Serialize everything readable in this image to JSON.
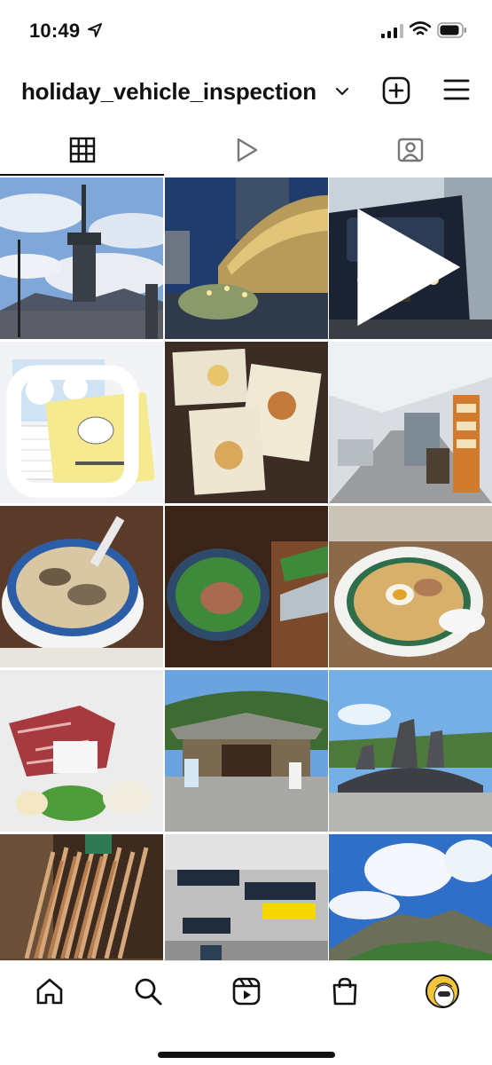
{
  "status_bar": {
    "time": "10:49"
  },
  "header": {
    "username": "holiday_vehicle_inspection"
  },
  "tabs": [
    {
      "name": "grid",
      "icon": "grid-icon",
      "active": true
    },
    {
      "name": "reels",
      "icon": "play-icon",
      "active": false
    },
    {
      "name": "tagged",
      "icon": "person-tag-icon",
      "active": false
    }
  ],
  "posts": [
    {
      "subject": "beppu-tower",
      "type": "photo"
    },
    {
      "subject": "station-building",
      "type": "photo"
    },
    {
      "subject": "black-train",
      "type": "reel"
    },
    {
      "subject": "calendar",
      "type": "carousel"
    },
    {
      "subject": "soup-packages",
      "type": "photo"
    },
    {
      "subject": "station-concourse",
      "type": "photo"
    },
    {
      "subject": "ramen-bowl",
      "type": "photo"
    },
    {
      "subject": "fish-dish",
      "type": "photo"
    },
    {
      "subject": "ramen-egg",
      "type": "photo"
    },
    {
      "subject": "horse-sashimi",
      "type": "photo"
    },
    {
      "subject": "shrine",
      "type": "photo"
    },
    {
      "subject": "stone-statues",
      "type": "photo"
    },
    {
      "subject": "chopsticks",
      "type": "photo"
    },
    {
      "subject": "station-signs",
      "type": "photo"
    },
    {
      "subject": "volcano",
      "type": "photo"
    }
  ],
  "bottom_nav": [
    {
      "name": "home",
      "icon": "home-icon"
    },
    {
      "name": "search",
      "icon": "search-icon"
    },
    {
      "name": "reels",
      "icon": "reels-icon"
    },
    {
      "name": "shop",
      "icon": "shop-icon"
    },
    {
      "name": "profile",
      "icon": "avatar"
    }
  ],
  "colors": {
    "text": "#111111",
    "background": "#ffffff"
  }
}
